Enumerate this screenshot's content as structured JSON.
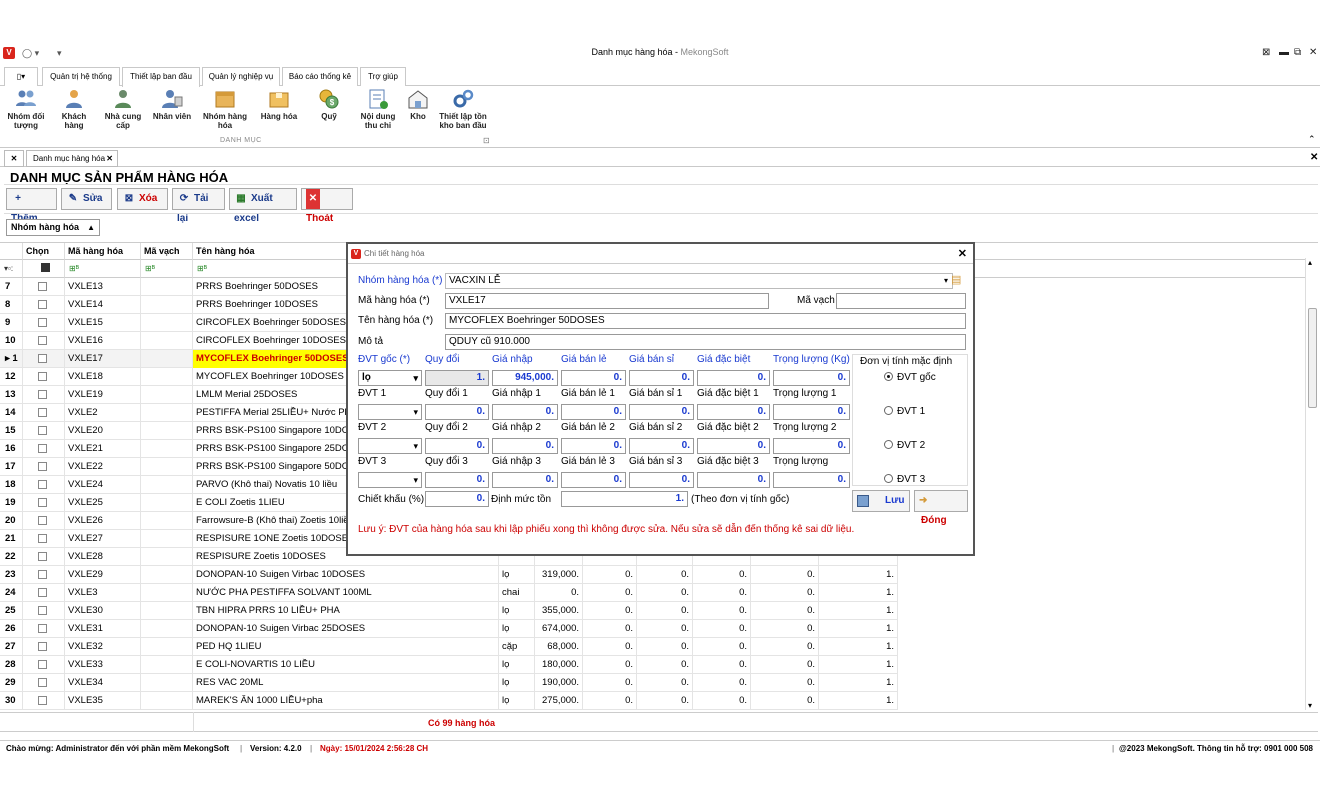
{
  "window": {
    "title": "Danh mục hàng hóa",
    "brand": "MekongSoft"
  },
  "ribbon_tabs": [
    "Quản trị hệ thống",
    "Thiết lập ban đầu",
    "Quản lý nghiệp vụ",
    "Báo cáo thống kê",
    "Trợ giúp"
  ],
  "ribbon": {
    "buttons": [
      {
        "line1": "Nhóm đối",
        "line2": "tượng"
      },
      {
        "line1": "Khách",
        "line2": "hàng"
      },
      {
        "line1": "Nhà cung",
        "line2": "cấp"
      },
      {
        "line1": "Nhân viên",
        "line2": ""
      },
      {
        "line1": "Nhóm hàng",
        "line2": "hóa"
      },
      {
        "line1": "Hàng hóa",
        "line2": ""
      },
      {
        "line1": "Quỹ",
        "line2": ""
      },
      {
        "line1": "Nội dung",
        "line2": "thu chi"
      },
      {
        "line1": "Kho",
        "line2": ""
      },
      {
        "line1": "Thiết lập tồn",
        "line2": "kho ban đầu"
      }
    ],
    "group_label": "DANH MỤC"
  },
  "doc_tab": "Danh mục hàng hóa",
  "page_title": "DANH MỤC SẢN PHẨM HÀNG HÓA",
  "toolbar": {
    "add": "Thêm",
    "edit": "Sửa",
    "delete": "Xóa",
    "reload": "Tải lại",
    "export": "Xuất excel",
    "exit": "Thoát"
  },
  "group_filter": "Nhóm hàng hóa",
  "grid": {
    "headers": {
      "chon": "Chọn",
      "ma": "Mã hàng hóa",
      "mavach": "Mã vạch",
      "ten": "Tên hàng hóa"
    },
    "rows": [
      {
        "stt": "7",
        "ma": "VXLE13",
        "ten": "PRRS Boehringer 50DOSES"
      },
      {
        "stt": "8",
        "ma": "VXLE14",
        "ten": "PRRS Boehringer 10DOSES"
      },
      {
        "stt": "9",
        "ma": "VXLE15",
        "ten": "CIRCOFLEX Boehringer 50DOSES"
      },
      {
        "stt": "10",
        "ma": "VXLE16",
        "ten": "CIRCOFLEX Boehringer 10DOSES"
      },
      {
        "stt": "1",
        "ma": "VXLE17",
        "ten": "MYCOFLEX Boehringer 50DOSES"
      },
      {
        "stt": "12",
        "ma": "VXLE18",
        "ten": "MYCOFLEX Boehringer 10DOSES"
      },
      {
        "stt": "13",
        "ma": "VXLE19",
        "ten": "LMLM Merial 25DOSES"
      },
      {
        "stt": "14",
        "ma": "VXLE2",
        "ten": "PESTIFFA Merial 25LIỀU+ Nước Pha"
      },
      {
        "stt": "15",
        "ma": "VXLE20",
        "ten": "PRRS BSK-PS100 Singapore 10DOSES"
      },
      {
        "stt": "16",
        "ma": "VXLE21",
        "ten": "PRRS BSK-PS100 Singapore 25DOSES"
      },
      {
        "stt": "17",
        "ma": "VXLE22",
        "ten": "PRRS BSK-PS100 Singapore 50DOSES"
      },
      {
        "stt": "18",
        "ma": "VXLE24",
        "ten": "PARVO (Khô thai) Novatis 10 liều"
      },
      {
        "stt": "19",
        "ma": "VXLE25",
        "ten": "E COLI  Zoetis 1LIEU"
      },
      {
        "stt": "20",
        "ma": "VXLE26",
        "ten": "Farrowsure-B (Khô thai) Zoetis 10liều"
      },
      {
        "stt": "21",
        "ma": "VXLE27",
        "ten": "RESPISURE 1ONE Zoetis 10DOSES"
      },
      {
        "stt": "22",
        "ma": "VXLE28",
        "ten": "RESPISURE Zoetis 10DOSES"
      },
      {
        "stt": "23",
        "ma": "VXLE29",
        "ten": "DONOPAN-10 Suigen Virbac 10DOSES",
        "dvt": "lọ",
        "gia": "319,000.",
        "c1": "0.",
        "c2": "0.",
        "c3": "0.",
        "c4": "0.",
        "c5": "1."
      },
      {
        "stt": "24",
        "ma": "VXLE3",
        "ten": "NƯỚC PHA PESTIFFA SOLVANT 100ML",
        "dvt": "chai",
        "gia": "0.",
        "c1": "0.",
        "c2": "0.",
        "c3": "0.",
        "c4": "0.",
        "c5": "1."
      },
      {
        "stt": "25",
        "ma": "VXLE30",
        "ten": "TBN HIPRA PRRS 10 LIỀU+ PHA",
        "dvt": "lọ",
        "gia": "355,000.",
        "c1": "0.",
        "c2": "0.",
        "c3": "0.",
        "c4": "0.",
        "c5": "1."
      },
      {
        "stt": "26",
        "ma": "VXLE31",
        "ten": "DONOPAN-10 Suigen Virbac 25DOSES",
        "dvt": "lọ",
        "gia": "674,000.",
        "c1": "0.",
        "c2": "0.",
        "c3": "0.",
        "c4": "0.",
        "c5": "1."
      },
      {
        "stt": "27",
        "ma": "VXLE32",
        "ten": "PED HQ 1LIEU",
        "dvt": "cặp",
        "gia": "68,000.",
        "c1": "0.",
        "c2": "0.",
        "c3": "0.",
        "c4": "0.",
        "c5": "1."
      },
      {
        "stt": "28",
        "ma": "VXLE33",
        "ten": "E COLI-NOVARTIS 10 LIỀU",
        "dvt": "lọ",
        "gia": "180,000.",
        "c1": "0.",
        "c2": "0.",
        "c3": "0.",
        "c4": "0.",
        "c5": "1."
      },
      {
        "stt": "29",
        "ma": "VXLE34",
        "ten": "RES VAC 20ML",
        "dvt": "lọ",
        "gia": "190,000.",
        "c1": "0.",
        "c2": "0.",
        "c3": "0.",
        "c4": "0.",
        "c5": "1."
      },
      {
        "stt": "30",
        "ma": "VXLE35",
        "ten": "MAREK'S ĂN 1000 LIỀU+pha",
        "dvt": "lọ",
        "gia": "275,000.",
        "c1": "0.",
        "c2": "0.",
        "c3": "0.",
        "c4": "0.",
        "c5": "1."
      }
    ],
    "count_text": "Có 99 hàng hóa"
  },
  "status": {
    "welcome": "Chào mừng: Administrator đến với phần mềm MekongSoft",
    "version": "Version: 4.2.0",
    "date": "Ngày: 15/01/2024 2:56:28 CH",
    "copyright": "@2023 MekongSoft. Thông tin hỗ trợ: 0901 000 508"
  },
  "dialog": {
    "title": "Chi tiết hàng hóa",
    "group_label": "Nhóm hàng hóa (*)",
    "group_value": "VACXIN LỄ",
    "code_label": "Mã hàng hóa (*)",
    "code_value": "VXLE17",
    "barcode_label": "Mã vạch",
    "barcode_value": "",
    "name_label": "Tên hàng hóa (*)",
    "name_value": "MYCOFLEX Boehringer 50DOSES",
    "desc_label": "Mô tả",
    "desc_value": "QDUY cũ 910.000",
    "unit_rows": [
      {
        "u": "ĐVT gốc (*)",
        "qd": "Quy đổi",
        "gn": "Giá nhập",
        "gl": "Giá bán lẻ",
        "gs": "Giá bán sỉ",
        "gd": "Giá đặc biệt",
        "tl": "Trọng lượng (Kg)",
        "unit_val": "lọ",
        "qd_val": "1.",
        "gn_val": "945,000.",
        "gl_val": "0.",
        "gs_val": "0.",
        "gd_val": "0.",
        "tl_val": "0."
      },
      {
        "u": "ĐVT 1",
        "qd": "Quy đổi  1",
        "gn": "Giá nhập 1",
        "gl": "Giá bán lẻ 1",
        "gs": "Giá bán sỉ 1",
        "gd": "Giá đặc biệt 1",
        "tl": "Trọng lượng 1",
        "unit_val": "",
        "qd_val": "0.",
        "gn_val": "0.",
        "gl_val": "0.",
        "gs_val": "0.",
        "gd_val": "0.",
        "tl_val": "0."
      },
      {
        "u": "ĐVT 2",
        "qd": "Quy đổi 2",
        "gn": "Giá nhập 2",
        "gl": "Giá bán lẻ 2",
        "gs": "Giá bán sỉ 2",
        "gd": "Giá đặc biệt 2",
        "tl": "Trọng lượng 2",
        "unit_val": "",
        "qd_val": "0.",
        "gn_val": "0.",
        "gl_val": "0.",
        "gs_val": "0.",
        "gd_val": "0.",
        "tl_val": "0."
      },
      {
        "u": "ĐVT 3",
        "qd": "Quy đổi 3",
        "gn": "Giá nhập 3",
        "gl": "Giá bán lẻ 3",
        "gs": "Giá bán sỉ 3",
        "gd": "Giá đặc biệt 3",
        "tl": "Trọng lượng",
        "unit_val": "",
        "qd_val": "0.",
        "gn_val": "0.",
        "gl_val": "0.",
        "gs_val": "0.",
        "gd_val": "0.",
        "tl_val": "0."
      }
    ],
    "default_unit_label": "Đơn vị tính mặc định",
    "radios": [
      "ĐVT gốc",
      "ĐVT 1",
      "ĐVT 2",
      "ĐVT 3"
    ],
    "discount_label": "Chiết khấu (%)",
    "discount_value": "0.",
    "min_stock_label": "Định mức tồn",
    "min_stock_value": "1.",
    "min_stock_note": "(Theo đơn vị tính gốc)",
    "save": "Lưu",
    "close": "Đóng",
    "warning": "Lưu ý: ĐVT của hàng hóa sau khi lập phiếu xong thì không được sửa. Nếu sửa sẽ dẫn đến thống kê sai dữ liệu."
  }
}
